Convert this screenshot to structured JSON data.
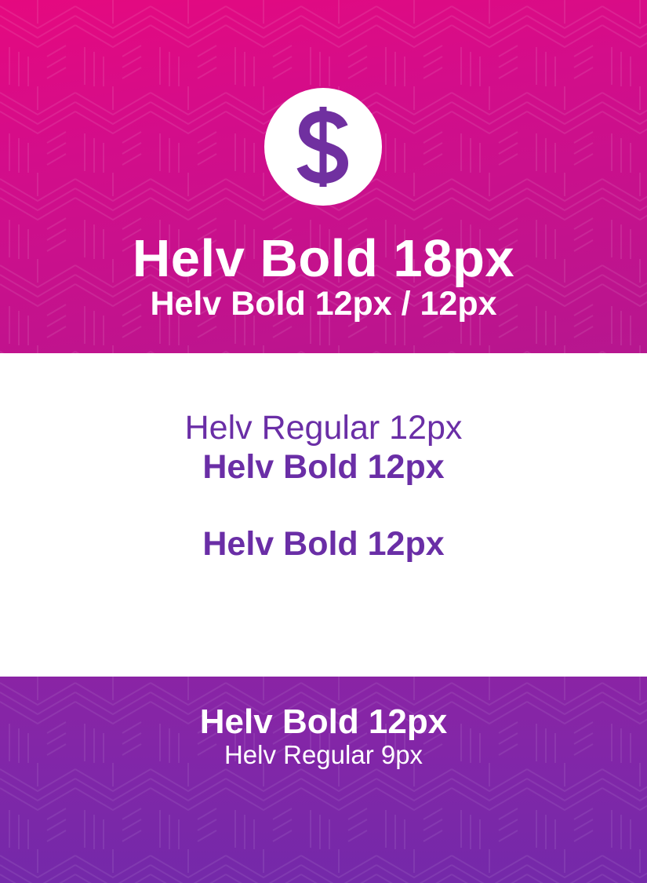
{
  "colors": {
    "top_banner_start": "#e5097f",
    "top_banner_end": "#b6168f",
    "bottom_banner": "#7f27a8",
    "text_purple": "#6a2ea6",
    "white": "#ffffff"
  },
  "header": {
    "icon": "dollar-sign-icon",
    "title": "Helv Bold 18px",
    "subtitle": "Helv Bold 12px / 12px"
  },
  "body": {
    "regular_line": "Helv Regular 12px",
    "bold_line_1": "Helv Bold 12px",
    "bold_line_2": "Helv Bold 12px"
  },
  "footer": {
    "title": "Helv Bold 12px",
    "subtitle": "Helv Regular 9px"
  }
}
